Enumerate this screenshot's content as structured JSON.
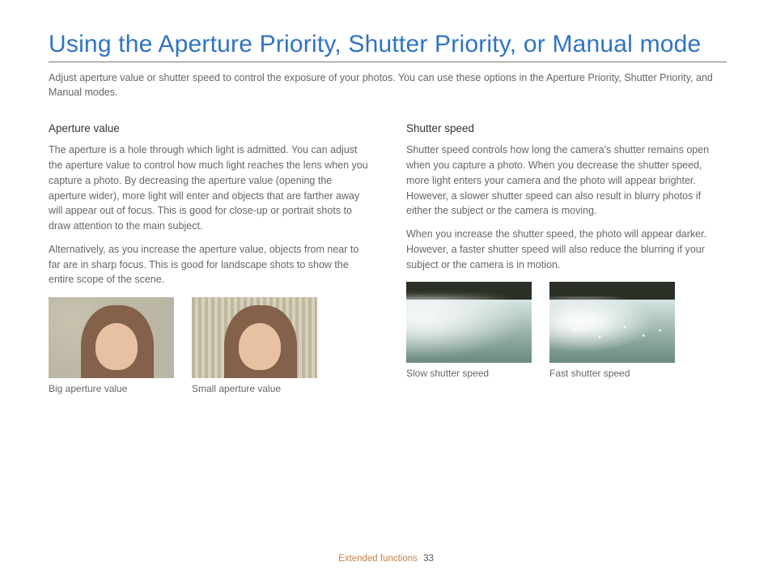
{
  "title": "Using the Aperture Priority, Shutter Priority, or Manual mode",
  "intro": "Adjust aperture value or shutter speed to control the exposure of your photos. You can use these options in the Aperture Priority, Shutter Priority, and Manual modes.",
  "left": {
    "heading": "Aperture value",
    "p1": "The aperture is a hole through which light is admitted. You can adjust the aperture value to control how much light reaches the lens when you capture a photo. By decreasing the aperture value (opening the aperture wider), more light will enter and objects that are farther away will appear out of focus. This is good for close-up or portrait shots to draw attention to the main subject.",
    "p2": "Alternatively, as you increase the aperture value, objects from near to far are in sharp focus. This is good for landscape shots to show the entire scope of the scene.",
    "fig1_caption": "Big aperture value",
    "fig2_caption": "Small aperture value"
  },
  "right": {
    "heading": "Shutter speed",
    "p1": "Shutter speed controls how long the camera's shutter remains open when you capture a photo. When you decrease the shutter speed, more light enters your camera and the photo will appear brighter. However, a slower shutter speed can also result in blurry photos if either the subject or the camera is moving.",
    "p2": "When you increase the shutter speed, the photo will appear darker. However, a faster shutter speed will also reduce the blurring if your subject or the camera is in motion.",
    "fig1_caption": "Slow shutter speed",
    "fig2_caption": "Fast shutter speed"
  },
  "footer": {
    "section": "Extended functions",
    "page": "33"
  }
}
